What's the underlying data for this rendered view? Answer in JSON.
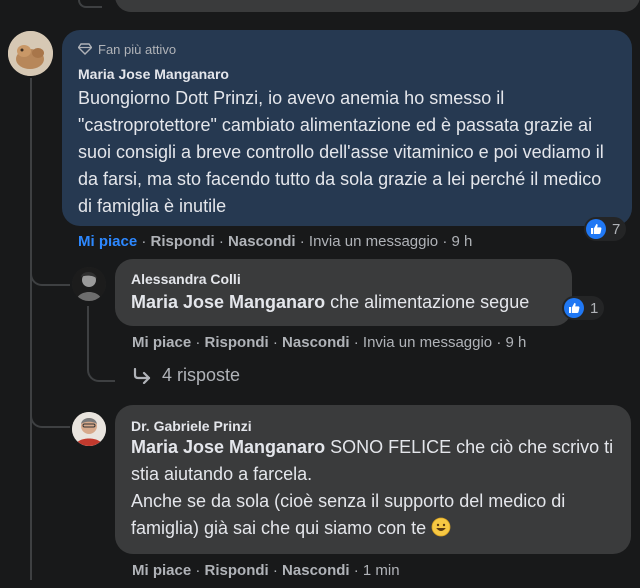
{
  "comment": {
    "badge": "Fan più attivo",
    "author": "Maria Jose Manganaro",
    "text": "Buongiorno Dott Prinzi, io avevo anemia ho smesso il \"castroprotettore\" cambiato alimentazione ed è passata grazie ai suoi consigli a breve controllo dell'asse vitaminico e poi vediamo il da farsi, ma sto facendo tutto da sola grazie a lei perché il medico di famiglia è inutile",
    "reaction_count": "7",
    "actions": {
      "like": "Mi piace",
      "reply": "Rispondi",
      "hide": "Nascondi",
      "message": "Invia un messaggio",
      "time": "9 h"
    }
  },
  "reply1": {
    "author": "Alessandra Colli",
    "mention": "Maria Jose Manganaro",
    "text": "che alimentazione segue",
    "reaction_count": "1",
    "actions": {
      "like": "Mi piace",
      "reply": "Rispondi",
      "hide": "Nascondi",
      "message": "Invia un messaggio",
      "time": "9 h"
    },
    "more_replies": "4 risposte"
  },
  "reply2": {
    "author": "Dr. Gabriele Prinzi",
    "mention": "Maria Jose Manganaro",
    "text": "SONO FELICE che ciò che scrivo ti stia aiutando a farcela.",
    "text2": "Anche se da sola (cioè senza il supporto del medico di famiglia) già sai che qui siamo con te",
    "emoji": "😀",
    "actions": {
      "like": "Mi piace",
      "reply": "Rispondi",
      "hide": "Nascondi",
      "time": "1 min"
    }
  },
  "colors": {
    "background": "#18191a",
    "highlight_bubble": "#263951",
    "reply_bubble": "#3a3b3c",
    "like_blue": "#2078f4",
    "link_blue": "#2d88ff",
    "muted_text": "#b0b3b8"
  }
}
